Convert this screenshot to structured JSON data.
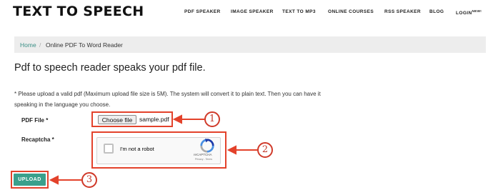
{
  "brand": {
    "logo": "TEXT TO SPEECH"
  },
  "nav": {
    "items": [
      "PDF SPEAKER",
      "IMAGE SPEAKER",
      "TEXT TO MP3",
      "ONLINE COURSES",
      "RSS SPEAKER",
      "BLOG"
    ],
    "login_label": "LOGIN",
    "login_badge": "NEW!"
  },
  "breadcrumb": {
    "home": "Home",
    "separator": "/",
    "current": "Online PDF To Word Reader"
  },
  "page": {
    "heading": "Pdf to speech reader speaks your pdf file.",
    "note": "* Please upload a valid pdf (Maximum upload file size is 5M). The system will convert it to plain text. Then you can have it speaking in the language you choose."
  },
  "form": {
    "pdf_label": "PDF File *",
    "choose_file_label": "Choose file",
    "file_name": "sample.pdf",
    "recaptcha_label": "Recaptcha *",
    "robot_label": "I'm not a robot",
    "recaptcha_brand": "reCAPTCHA",
    "recaptcha_links": "Privacy - Terms",
    "upload_label": "UPLOAD"
  },
  "annotations": {
    "markers": [
      "1",
      "2",
      "3"
    ]
  },
  "colors": {
    "accent": "#3aa08c",
    "annotation": "#e3422b",
    "link": "#3a8f86"
  }
}
